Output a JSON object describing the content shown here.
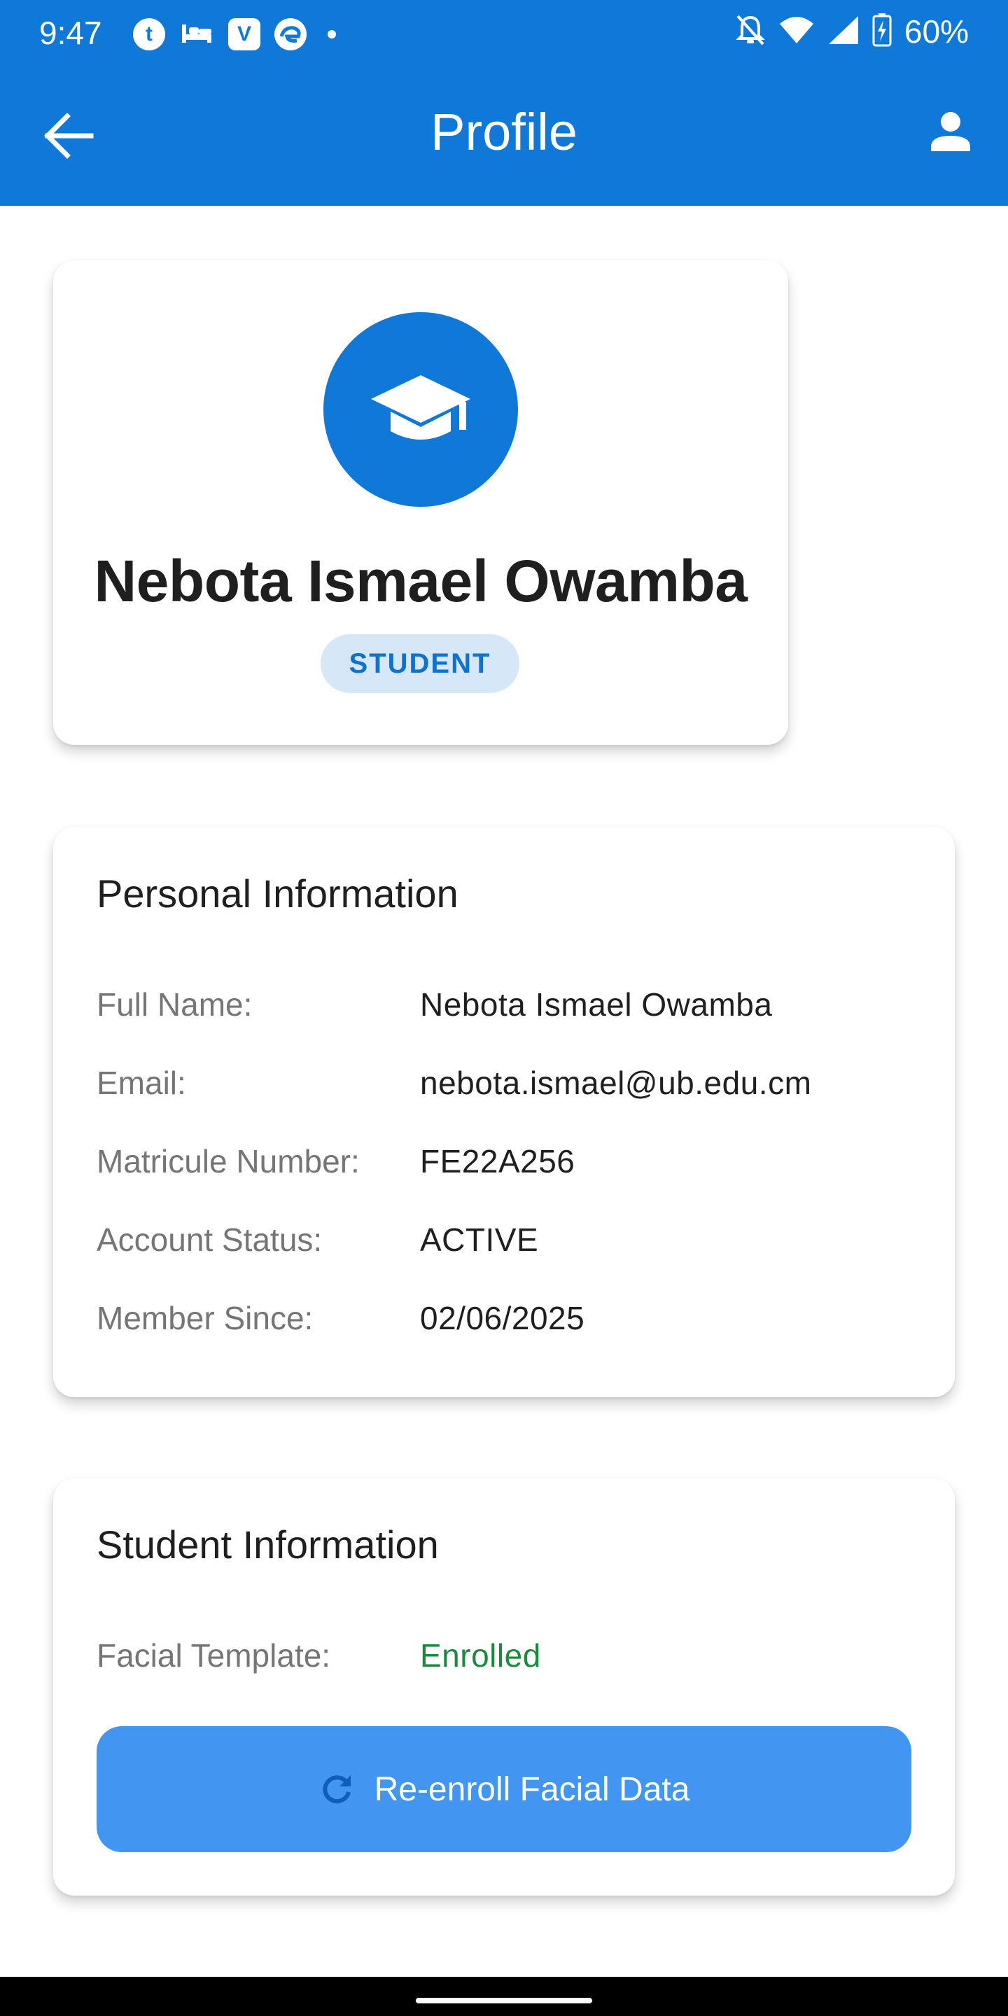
{
  "status_bar": {
    "time": "9:47",
    "battery": "60%",
    "icons": [
      "app-icon",
      "hotel-icon",
      "v-app-icon",
      "edge-icon",
      "dot-icon",
      "notifications-off-icon",
      "wifi-icon",
      "signal-icon",
      "battery-charging-icon"
    ]
  },
  "app_bar": {
    "title": "Profile",
    "back_icon": "arrow-back-icon",
    "profile_icon": "person-icon"
  },
  "profile": {
    "avatar_icon": "graduation-cap-icon",
    "name": "Nebota Ismael Owamba",
    "role": "STUDENT"
  },
  "personal_info": {
    "title": "Personal Information",
    "rows": [
      {
        "label": "Full Name:",
        "value": "Nebota Ismael Owamba"
      },
      {
        "label": "Email:",
        "value": "nebota.ismael@ub.edu.cm"
      },
      {
        "label": "Matricule Number:",
        "value": "FE22A256"
      },
      {
        "label": "Account Status:",
        "value": "ACTIVE"
      },
      {
        "label": "Member Since:",
        "value": "02/06/2025"
      }
    ]
  },
  "student_info": {
    "title": "Student Information",
    "facial_label": "Facial Template:",
    "facial_value": "Enrolled",
    "reenroll_label": "Re-enroll Facial Data",
    "reenroll_icon": "refresh-icon"
  },
  "colors": {
    "primary": "#0f78d8",
    "button": "#4295f0",
    "badge_bg": "#d6e8f8",
    "success": "#1b8a3c"
  }
}
